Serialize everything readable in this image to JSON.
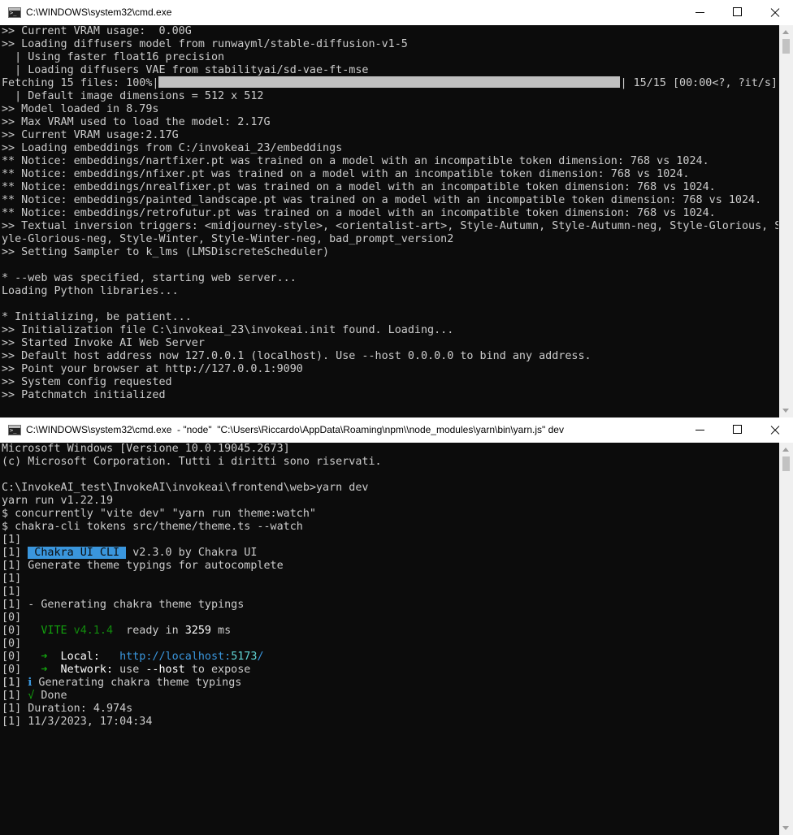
{
  "top_window": {
    "title": "C:\\WINDOWS\\system32\\cmd.exe",
    "lines": [
      ">> Current VRAM usage:  0.00G",
      ">> Loading diffusers model from runwayml/stable-diffusion-v1-5",
      "  | Using faster float16 precision",
      "  | Loading diffusers VAE from stabilityai/sd-vae-ft-mse",
      "",
      "  | Default image dimensions = 512 x 512",
      ">> Model loaded in 8.79s",
      ">> Max VRAM used to load the model: 2.17G",
      ">> Current VRAM usage:2.17G",
      ">> Loading embeddings from C:/invokeai_23/embeddings",
      "** Notice: embeddings/nartfixer.pt was trained on a model with an incompatible token dimension: 768 vs 1024.",
      "** Notice: embeddings/nfixer.pt was trained on a model with an incompatible token dimension: 768 vs 1024.",
      "** Notice: embeddings/nrealfixer.pt was trained on a model with an incompatible token dimension: 768 vs 1024.",
      "** Notice: embeddings/painted_landscape.pt was trained on a model with an incompatible token dimension: 768 vs 1024.",
      "** Notice: embeddings/retrofutur.pt was trained on a model with an incompatible token dimension: 768 vs 1024.",
      ">> Textual inversion triggers: <midjourney-style>, <orientalist-art>, Style-Autumn, Style-Autumn-neg, Style-Glorious, St",
      "yle-Glorious-neg, Style-Winter, Style-Winter-neg, bad_prompt_version2",
      ">> Setting Sampler to k_lms (LMSDiscreteScheduler)",
      "",
      "* --web was specified, starting web server...",
      "Loading Python libraries...",
      "",
      "* Initializing, be patient...",
      ">> Initialization file C:\\invokeai_23\\invokeai.init found. Loading...",
      ">> Started Invoke AI Web Server",
      ">> Default host address now 127.0.0.1 (localhost). Use --host 0.0.0.0 to bind any address.",
      ">> Point your browser at http://127.0.0.1:9090",
      ">> System config requested",
      ">> Patchmatch initialized"
    ],
    "progress": {
      "prefix": "Fetching 15 files: 100%|",
      "fraction": 1.0,
      "suffix": "| 15/15 [00:00<?, ?it/s]"
    }
  },
  "bottom_window": {
    "title": "C:\\WINDOWS\\system32\\cmd.exe  - \"node\"  \"C:\\Users\\Riccardo\\AppData\\Roaming\\npm\\\\node_modules\\yarn\\bin\\yarn.js\" dev",
    "lines": [
      "Microsoft Windows [Versione 10.0.19045.2673]",
      "(c) Microsoft Corporation. Tutti i diritti sono riservati.",
      "",
      "C:\\InvokeAI_test\\InvokeAI\\invokeai\\frontend\\web>yarn dev",
      "yarn run v1.22.19",
      "$ concurrently \"vite dev\" \"yarn run theme:watch\"",
      "$ chakra-cli tokens src/theme/theme.ts --watch",
      "[1]",
      "",
      "[1] Generate theme typings for autocomplete",
      "[1]",
      "[1]",
      "[1] - Generating chakra theme typings",
      "[0]",
      "",
      "[0]",
      "",
      "",
      "[1] ",
      "",
      "[1] Duration: 4.974s",
      "[1] 11/3/2023, 17:04:34"
    ],
    "chakra_line": {
      "prefix": "[1] ",
      "badge": " Chakra UI CLI ",
      "suffix": " v2.3.0 by Chakra UI"
    },
    "vite_line": {
      "prefix": "[0]   ",
      "name": "VITE",
      "version": " v4.1.4",
      "mid": "  ready in ",
      "ms": "3259",
      "unit": " ms"
    },
    "local_line": {
      "prefix": "[0]   ",
      "arrow": "➜",
      "label": "  Local:",
      "pad": "   ",
      "url_a": "http://localhost:",
      "port": "5173",
      "url_b": "/"
    },
    "network_line": {
      "prefix": "[0]   ",
      "arrow": "➜",
      "label": "  Network:",
      "text_a": " use ",
      "flag": "--host",
      "text_b": " to expose"
    },
    "generating_line": {
      "prefix": "[1] ",
      "icon": "ℹ",
      "text": " Generating chakra theme typings"
    },
    "done_line": {
      "prefix": "[1] ",
      "check": "√",
      "text": " Done"
    }
  }
}
